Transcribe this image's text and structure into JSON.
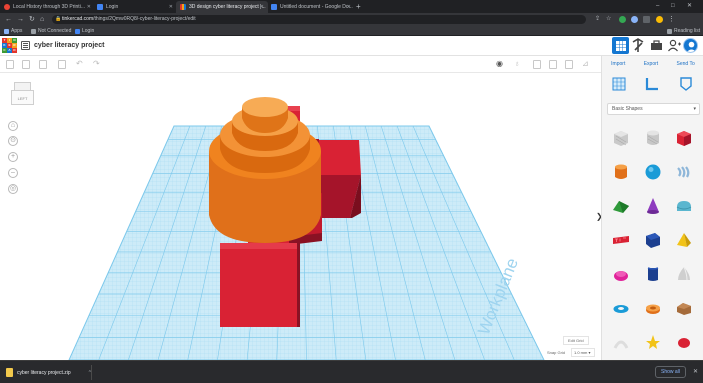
{
  "browser": {
    "tabs": [
      {
        "label": "Local History through 3D Printi...",
        "active": false,
        "favicon_color": "#ea4335"
      },
      {
        "label": "Login",
        "active": false,
        "favicon_color": "#4285f4"
      },
      {
        "label": "3D design cyber literacy project |...",
        "active": true,
        "favicon_color": "#34a853"
      },
      {
        "label": "Untitled document - Google Do...",
        "active": false,
        "favicon_color": "#4285f4"
      }
    ],
    "new_tab": "+",
    "window_controls": [
      "–",
      "□",
      "✕"
    ],
    "url_domain": "tinkercad.com",
    "url_path": "/things/2Qmw0RQ8/-cyber-literacy-project/edit",
    "bookmarks": [
      {
        "label": "Apps",
        "color": "#8ab4f8"
      },
      {
        "label": "Not Connected",
        "color": "#9aa0a6"
      },
      {
        "label": "Login",
        "color": "#4285f4"
      }
    ],
    "reading_list": "Reading list"
  },
  "app": {
    "logo_letters": [
      "T",
      "I",
      "N",
      "K",
      "E",
      "R",
      "C",
      "A",
      "D"
    ],
    "logo_colors": [
      "#e2352c",
      "#f5a11c",
      "#3d9b35",
      "#1477d1",
      "#e2352c",
      "#f5a11c",
      "#3d9b35",
      "#1477d1",
      "#e2352c"
    ],
    "design_title": "cyber literacy project"
  },
  "panel": {
    "actions": [
      "Import",
      "Export",
      "Send To"
    ],
    "shape_category": "Basic Shapes"
  },
  "viewport": {
    "viewcube_label": "LEFT",
    "zoom_controls": [
      "⌂",
      "⊙",
      "+",
      "–",
      "◎"
    ],
    "workplane_label": "Workplane",
    "edit_grid": "Edit Grid",
    "snap_grid_label": "Snap Grid",
    "snap_grid_value": "1.0 mm ▾"
  },
  "downloads": {
    "file_name": "cyber literacy project.zip",
    "show_all": "Show all"
  },
  "colors": {
    "accent": "#1477d1",
    "grid": "#8fd3f0",
    "box_red": "#d92234",
    "cylinder_orange": "#f0831f"
  }
}
